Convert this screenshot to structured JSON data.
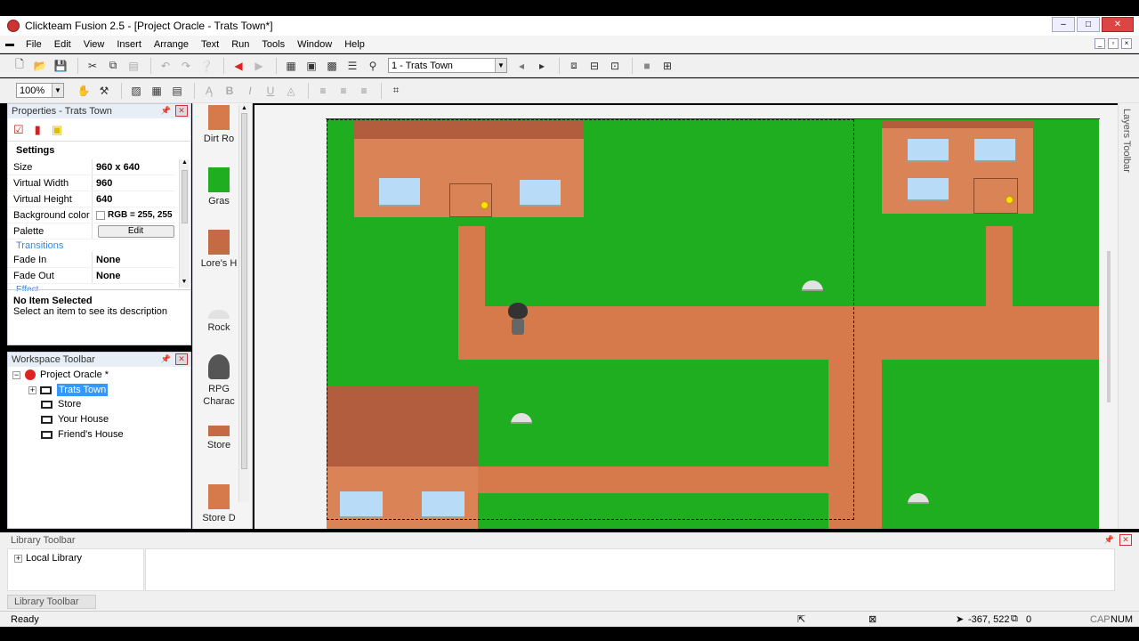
{
  "app": {
    "title": "Clickteam Fusion 2.5 - [Project Oracle - Trats Town*]"
  },
  "menu": [
    "File",
    "Edit",
    "View",
    "Insert",
    "Arrange",
    "Text",
    "Run",
    "Tools",
    "Window",
    "Help"
  ],
  "toolbar": {
    "frame_select": "1 - Trats Town",
    "zoom": "100%"
  },
  "properties": {
    "title": "Properties - Trats Town",
    "section_settings": "Settings",
    "rows": [
      {
        "label": "Size",
        "value": "960 x 640"
      },
      {
        "label": "Virtual Width",
        "value": "960"
      },
      {
        "label": "Virtual Height",
        "value": "640"
      },
      {
        "label": "Background color",
        "value": "RGB = 255, 255"
      },
      {
        "label": "Palette",
        "value": "Edit"
      }
    ],
    "section_transitions": "Transitions",
    "transitions": [
      {
        "label": "Fade In",
        "value": "None"
      },
      {
        "label": "Fade Out",
        "value": "None"
      }
    ],
    "section_effect": "Effect",
    "desc_title": "No Item Selected",
    "desc_text": "Select an item to see its description"
  },
  "workspace": {
    "title": "Workspace Toolbar",
    "project": "Project Oracle *",
    "frames": [
      "Trats Town",
      "Store",
      "Your House",
      "Friend's House"
    ]
  },
  "objects": [
    {
      "label": "Dirt Ro",
      "color": "#d67a4c"
    },
    {
      "label": "Gras",
      "color": "#1fae1f"
    },
    {
      "label": "Lore's H",
      "color": "#c46a44"
    },
    {
      "label": "Rock",
      "color": "#e2e2e2"
    },
    {
      "label": "RPG Charac",
      "color": "#555555"
    },
    {
      "label": "Store",
      "color": "#c46a44"
    },
    {
      "label": "Store D",
      "color": "#d67a4c"
    }
  ],
  "layers_toolbar": "Layers Toolbar",
  "library": {
    "title": "Library Toolbar",
    "item": "Local Library",
    "tab": "Library Toolbar"
  },
  "status": {
    "text": "Ready",
    "coords": "-367, 522",
    "layer": "0",
    "cap": "CAP",
    "num": "NUM"
  }
}
